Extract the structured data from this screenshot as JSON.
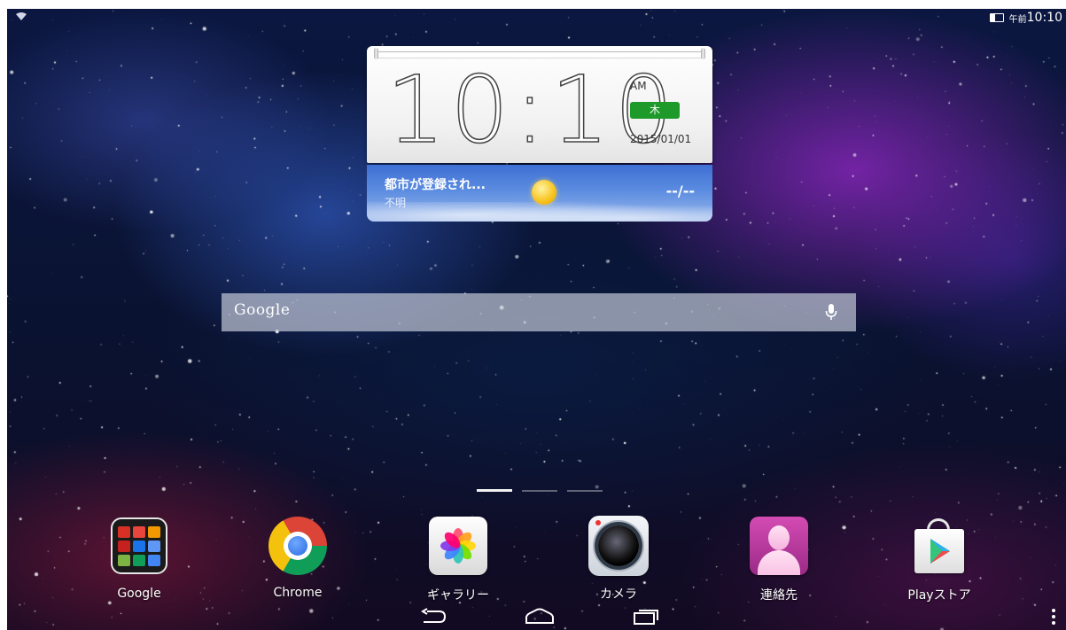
{
  "status_bar": {
    "wifi_icon": "wifi-signal-icon",
    "battery_icon": "battery-icon",
    "ampm": "午前",
    "time": "10:10"
  },
  "clock_widget": {
    "time": "10:10",
    "ampm": "AM",
    "day": "木",
    "date": "2015/01/01",
    "day_badge_color": "#1e9a2a"
  },
  "weather": {
    "city": "都市が登録され...",
    "condition": "不明",
    "temperature": "--/--",
    "icon": "sun-icon"
  },
  "search": {
    "logo": "Google",
    "mic_icon": "microphone-icon"
  },
  "page_indicator": {
    "count": 3,
    "active_index": 0
  },
  "dock": [
    {
      "label": "Google",
      "icon": "google-folder-icon"
    },
    {
      "label": "Chrome",
      "icon": "chrome-icon"
    },
    {
      "label": "ギャラリー",
      "icon": "gallery-icon"
    },
    {
      "label": "カメラ",
      "icon": "camera-icon"
    },
    {
      "label": "連絡先",
      "icon": "contacts-icon"
    },
    {
      "label": "Playストア",
      "icon": "play-store-icon"
    }
  ],
  "nav_bar": {
    "back_icon": "back-icon",
    "home_icon": "home-icon",
    "recents_icon": "recent-apps-icon",
    "overflow_icon": "overflow-menu-icon"
  }
}
